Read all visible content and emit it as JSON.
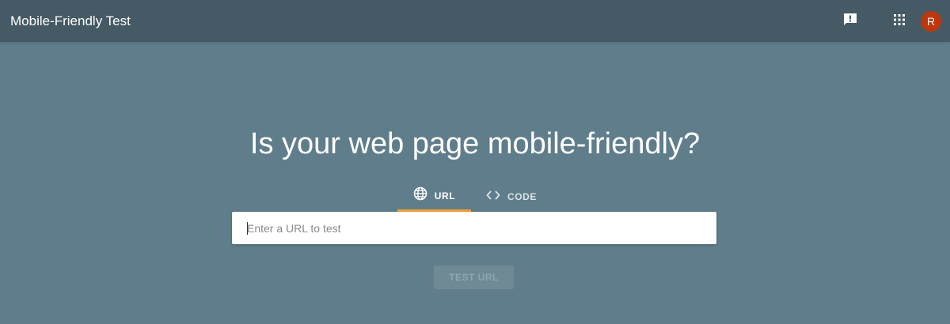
{
  "app": {
    "title": "Mobile-Friendly Test"
  },
  "header": {
    "feedback_icon": "feedback-icon",
    "apps_icon": "apps-grid-icon",
    "avatar_initial": "R",
    "avatar_color": "#bf360c"
  },
  "main": {
    "headline": "Is your web page mobile-friendly?",
    "tabs": [
      {
        "label": "URL",
        "icon": "globe-icon",
        "selected": true
      },
      {
        "label": "CODE",
        "icon": "code-icon",
        "selected": false
      }
    ],
    "url_input": {
      "placeholder": "Enter a URL to test",
      "value": ""
    },
    "test_button": {
      "label": "TEST URL",
      "enabled": false
    }
  },
  "colors": {
    "app_bar": "#455a64",
    "background": "#607d8b",
    "tab_indicator": "#f4a13a"
  }
}
